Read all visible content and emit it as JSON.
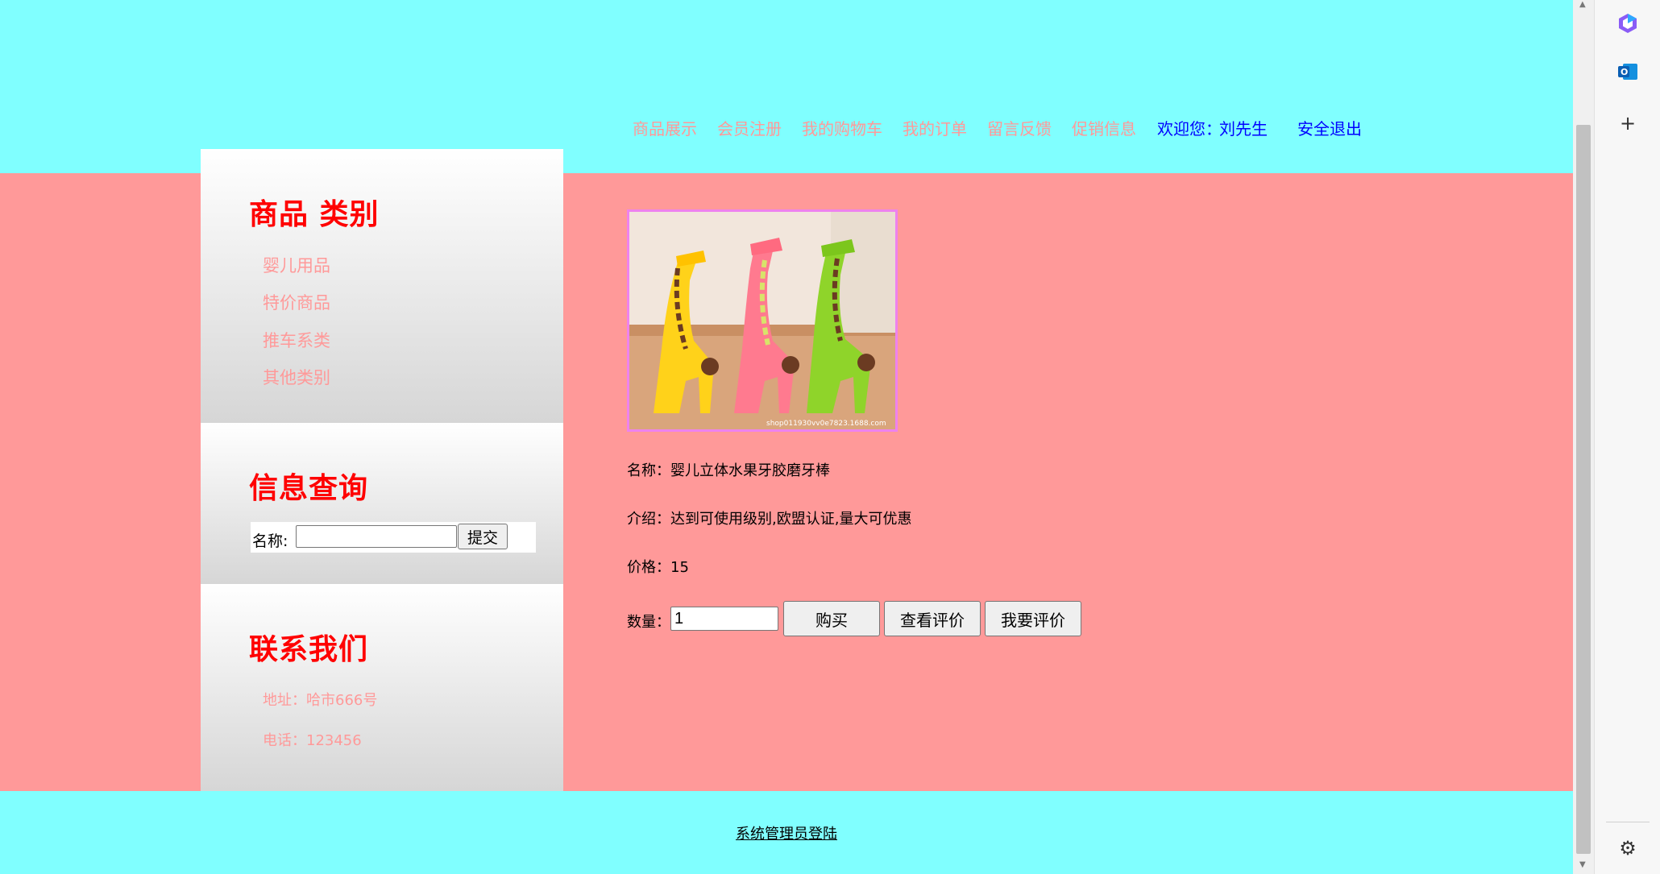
{
  "nav": {
    "items": [
      "商品展示",
      "会员注册",
      "我的购物车",
      "我的订单",
      "留言反馈",
      "促销信息"
    ],
    "welcome_label": "欢迎您：",
    "user_name": "刘先生",
    "logout": "安全退出"
  },
  "sidebar": {
    "categories_title": "商品 类别",
    "categories": [
      "婴儿用品",
      "特价商品",
      "推车系类",
      "其他类别"
    ],
    "search_title": "信息查询",
    "search_label": "名称:",
    "search_value": "",
    "search_submit": "提交",
    "contact_title": "联系我们",
    "address": "地址：哈市666号",
    "phone": "电话：123456"
  },
  "product": {
    "name_label": "名称：",
    "name": "婴儿立体水果牙胶磨牙棒",
    "intro_label": "介绍：",
    "intro": "达到可使用级别,欧盟认证,量大可优惠",
    "price_label": "价格：",
    "price": "15",
    "qty_label": "数量：",
    "qty_value": "1",
    "buy_button": "购买",
    "view_reviews_button": "查看评价",
    "write_review_button": "我要评价",
    "image_watermark": "shop011930vv0e7823.1688.com"
  },
  "footer": {
    "admin_login": "系统管理员登陆"
  },
  "colors": {
    "header_bg": "#80ffff",
    "main_bg": "#ff9999",
    "heading_red": "#ff0000",
    "link_pink": "#ff9999",
    "link_blue": "#0000ff"
  },
  "icons": {
    "panel_top": "copilot-icon",
    "panel_second": "outlook-icon",
    "panel_add": "plus-icon",
    "panel_settings": "gear-icon"
  }
}
